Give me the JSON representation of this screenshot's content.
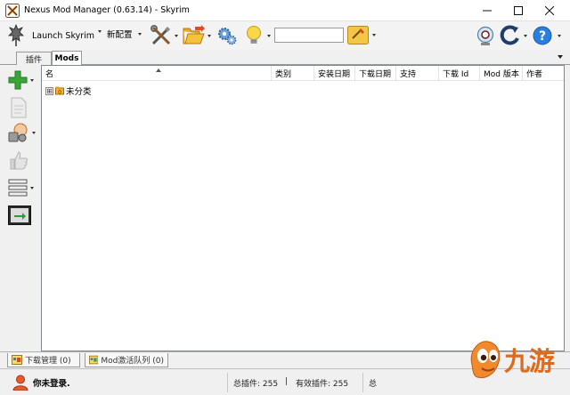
{
  "window": {
    "title": "Nexus Mod Manager (0.63.14) - Skyrim"
  },
  "toolbar": {
    "launch_label": "Launch Skyrim",
    "profile_label": "新配置",
    "search_value": ""
  },
  "tabs": {
    "plugins": "插件",
    "mods": "Mods"
  },
  "grid": {
    "columns": [
      "名",
      "类别",
      "安装日期",
      "下载日期",
      "支持",
      "下载 Id",
      "Mod 版本",
      "作者"
    ],
    "rows": [
      {
        "expander": "⊞",
        "label": "未分类"
      }
    ]
  },
  "bottom_tabs": {
    "downloads": "下载管理 (0)",
    "queue": "Mod激活队列 (0)"
  },
  "status": {
    "login": "你未登录.",
    "total_plugins": "总插件: 255",
    "separator": "|",
    "active_plugins": "有效插件: 255",
    "truncated": "总"
  },
  "watermark": {
    "text": "九游"
  },
  "colors": {
    "accent_green": "#3aa535",
    "help_blue": "#1e6fd0",
    "watermark_orange": "#e06a1c"
  }
}
